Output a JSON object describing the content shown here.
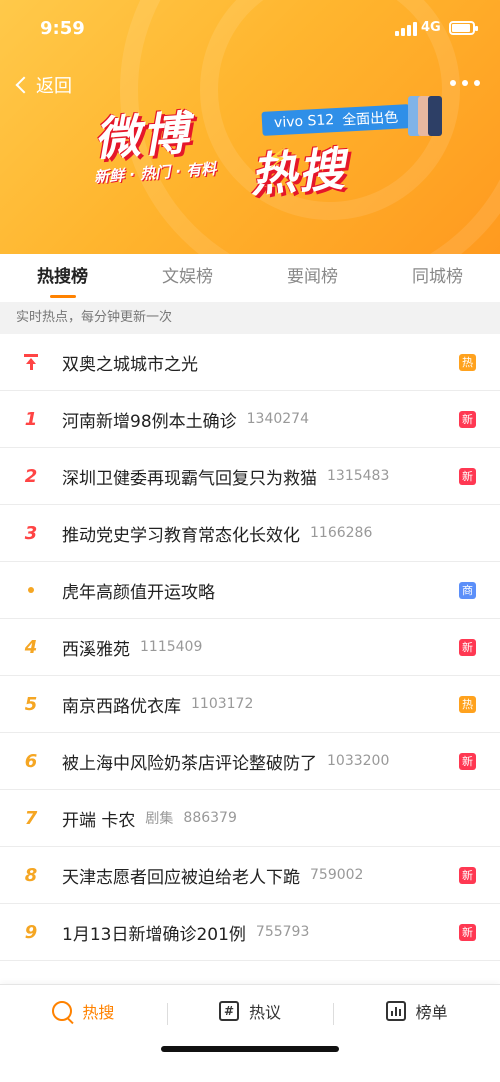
{
  "status": {
    "time": "9:59",
    "network": "4G"
  },
  "header": {
    "back_label": "返回",
    "logo_line1": "微博",
    "logo_line2": "热搜",
    "slogan": "新鲜 · 热门 · 有料",
    "ad_brand": "vivo S12",
    "ad_text": "全面出色"
  },
  "tabs": [
    "热搜榜",
    "文娱榜",
    "要闻榜",
    "同城榜"
  ],
  "subheader": "实时热点，每分钟更新一次",
  "items": [
    {
      "rank": "",
      "marker": "pin",
      "title": "双奥之城城市之光",
      "category": "",
      "count": "",
      "badge": "热",
      "badge_type": "hot"
    },
    {
      "rank": "1",
      "marker": "num",
      "title": "河南新增98例本土确诊",
      "category": "",
      "count": "1340274",
      "badge": "新",
      "badge_type": "new"
    },
    {
      "rank": "2",
      "marker": "num",
      "title": "深圳卫健委再现霸气回复只为救猫",
      "category": "",
      "count": "1315483",
      "badge": "新",
      "badge_type": "new"
    },
    {
      "rank": "3",
      "marker": "num",
      "title": "推动党史学习教育常态化长效化",
      "category": "",
      "count": "1166286",
      "badge": "",
      "badge_type": ""
    },
    {
      "rank": "",
      "marker": "dot",
      "title": "虎年高颜值开运攻略",
      "category": "",
      "count": "",
      "badge": "商",
      "badge_type": "biz"
    },
    {
      "rank": "4",
      "marker": "num",
      "title": "西溪雅苑",
      "category": "",
      "count": "1115409",
      "badge": "新",
      "badge_type": "new"
    },
    {
      "rank": "5",
      "marker": "num",
      "title": "南京西路优衣库",
      "category": "",
      "count": "1103172",
      "badge": "热",
      "badge_type": "hot"
    },
    {
      "rank": "6",
      "marker": "num",
      "title": "被上海中风险奶茶店评论整破防了",
      "category": "",
      "count": "1033200",
      "badge": "新",
      "badge_type": "new"
    },
    {
      "rank": "7",
      "marker": "num",
      "title": "开端 卡农",
      "category": "剧集",
      "count": "886379",
      "badge": "",
      "badge_type": ""
    },
    {
      "rank": "8",
      "marker": "num",
      "title": "天津志愿者回应被迫给老人下跪",
      "category": "",
      "count": "759002",
      "badge": "新",
      "badge_type": "new"
    },
    {
      "rank": "9",
      "marker": "num",
      "title": "1月13日新增确诊201例",
      "category": "",
      "count": "755793",
      "badge": "新",
      "badge_type": "new"
    }
  ],
  "bottom_nav": [
    {
      "label": "热搜",
      "icon": "hot-search-icon",
      "active": true
    },
    {
      "label": "热议",
      "icon": "topic-icon",
      "active": false
    },
    {
      "label": "榜单",
      "icon": "chart-icon",
      "active": false
    }
  ],
  "colors": {
    "accent": "#ff8200",
    "hot": "#ffa21e",
    "new": "#ff3852",
    "biz": "#5b8ff9",
    "rank_top": "#ff4444",
    "rank_mid": "#f5a623"
  }
}
